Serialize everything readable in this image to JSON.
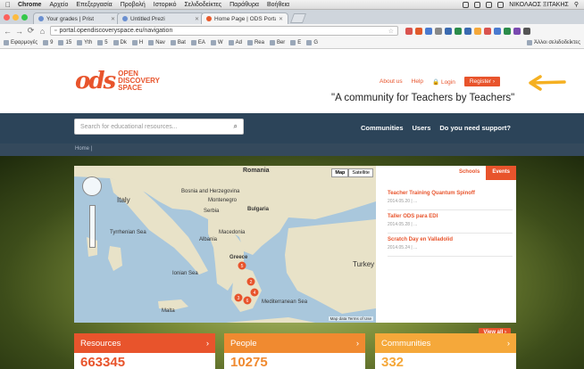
{
  "menubar": {
    "app": "Chrome",
    "items": [
      "Αρχείο",
      "Επεξεργασία",
      "Προβολή",
      "Ιστορικό",
      "Σελιδοδείκτες",
      "Παράθυρα",
      "Βοήθεια"
    ],
    "user": "ΝΙΚΟΛΑΟΣ ΞΙΤΑΚΗΣ"
  },
  "tabs": [
    {
      "title": "Your grades | Prist",
      "active": false
    },
    {
      "title": "Untitled Prezi",
      "active": false
    },
    {
      "title": "Home Page | ODS Portal",
      "active": true
    }
  ],
  "address": {
    "url": "portal.opendiscoveryspace.eu/navigation"
  },
  "bookmarks": {
    "items": [
      "Εφαρμογές",
      "9",
      "15",
      "Yth",
      "5",
      "Dk",
      "H",
      "Nav",
      "Bat",
      "EA",
      "W",
      "Ad",
      "Rea",
      "Ber",
      "E",
      "G"
    ],
    "other": "Άλλοι σελιδοδείκτες"
  },
  "site": {
    "logo_mark": "ods",
    "logo_name": [
      "OPEN",
      "DISCOVERY",
      "SPACE"
    ],
    "top_links": {
      "about": "About us",
      "help": "Help",
      "login": "Login",
      "register": "Register"
    },
    "tagline": "\"A community for Teachers by Teachers\"",
    "search_placeholder": "Search for educational resources...",
    "nav": [
      "Communities",
      "Users",
      "Do you need support?"
    ],
    "breadcrumb": "Home |"
  },
  "map": {
    "types": [
      "Map",
      "Satellite"
    ],
    "labels": [
      "Romania",
      "Bosnia and Herzegovina",
      "Serbia",
      "Italy",
      "Montenegro",
      "Bulgaria",
      "Macedonia",
      "Albania",
      "Tyrrhenian Sea",
      "Greece",
      "Turkey",
      "Mediterranean Sea",
      "Ionian Sea",
      "Malta"
    ],
    "footer": "Map data  Terms of Use"
  },
  "events": {
    "tabs": [
      "Schools",
      "Events"
    ],
    "active_tab": "Events",
    "items": [
      {
        "title": "Teacher Training Quantum Spinoff",
        "date": "2014.05.20 | ..."
      },
      {
        "title": "Taller ODS para EDI",
        "date": "2014.05.28 | ..."
      },
      {
        "title": "Scratch Day en Valladolid",
        "date": "2014.05.24 | ..."
      }
    ],
    "view_all": "View all"
  },
  "stats": [
    {
      "label": "Resources",
      "value": "663345",
      "color": "#e8542c"
    },
    {
      "label": "People",
      "value": "10275",
      "color": "#f08a30"
    },
    {
      "label": "Communities",
      "value": "332",
      "color": "#f5a83a"
    }
  ],
  "colors": {
    "brand": "#e8542c",
    "navbar": "#2c4459",
    "arrow": "#f5b021"
  }
}
